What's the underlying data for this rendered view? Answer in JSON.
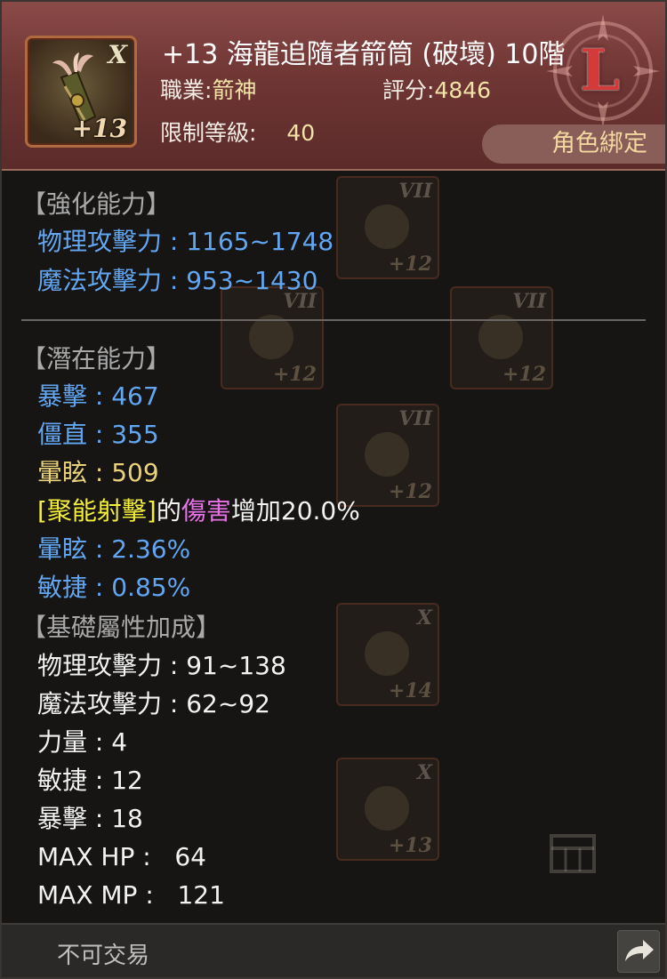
{
  "item": {
    "name": "+13 海龍追隨者箭筒 (破壞) 10階",
    "grade": "X",
    "enhance": "+13",
    "rank_letter": "L",
    "class_label": "職業:",
    "class_value": "箭神",
    "score_label": "評分:",
    "score_value": "4846",
    "level_label": "限制等級:",
    "level_value": "40",
    "bind": "角色綁定"
  },
  "sections": {
    "enhance_title": "【強化能力】",
    "enhance_stats": [
      "物理攻擊力 : 1165~1748",
      "魔法攻擊力 : 953~1430"
    ],
    "potential_title": "【潛在能力】",
    "potential_stats": [
      {
        "text": "暴擊 : 467",
        "color": "#62a6f2"
      },
      {
        "text": "僵直 : 355",
        "color": "#62a6f2"
      },
      {
        "text": "暈眩 : 509",
        "color": "#e9d27a"
      }
    ],
    "skill_line": {
      "skill": "[聚能射擊]",
      "connector": "的",
      "effect": "傷害",
      "suffix": "增加20.0%"
    },
    "potential_stats_2": [
      "暈眩 : 2.36%",
      "敏捷 : 0.85%"
    ],
    "base_title": "【基礎屬性加成】",
    "base_stats": [
      "物理攻擊力 : 91~138",
      "魔法攻擊力 : 62~92",
      "力量 : 4",
      "敏捷 : 12",
      "暴擊 : 18",
      "MAX HP :   64",
      "MAX MP :   121"
    ]
  },
  "background_slots": [
    {
      "grade": "VII",
      "enhance": "+12"
    },
    {
      "grade": "VII",
      "enhance": "+12"
    },
    {
      "grade": "VII",
      "enhance": "+12"
    },
    {
      "grade": "VII",
      "enhance": "+12"
    },
    {
      "grade": "X",
      "enhance": "+14"
    },
    {
      "grade": "X",
      "enhance": "+13"
    }
  ],
  "footer": {
    "trade": "不可交易",
    "share_icon": "share-arrow-icon"
  },
  "colors": {
    "header_bg": "#6f3634",
    "stat_blue": "#62a6f2",
    "stat_gold": "#e9d27a",
    "skill_yellow": "#f4ef3a",
    "effect_pink": "#e873e8",
    "rank_red": "#d33a3a"
  }
}
